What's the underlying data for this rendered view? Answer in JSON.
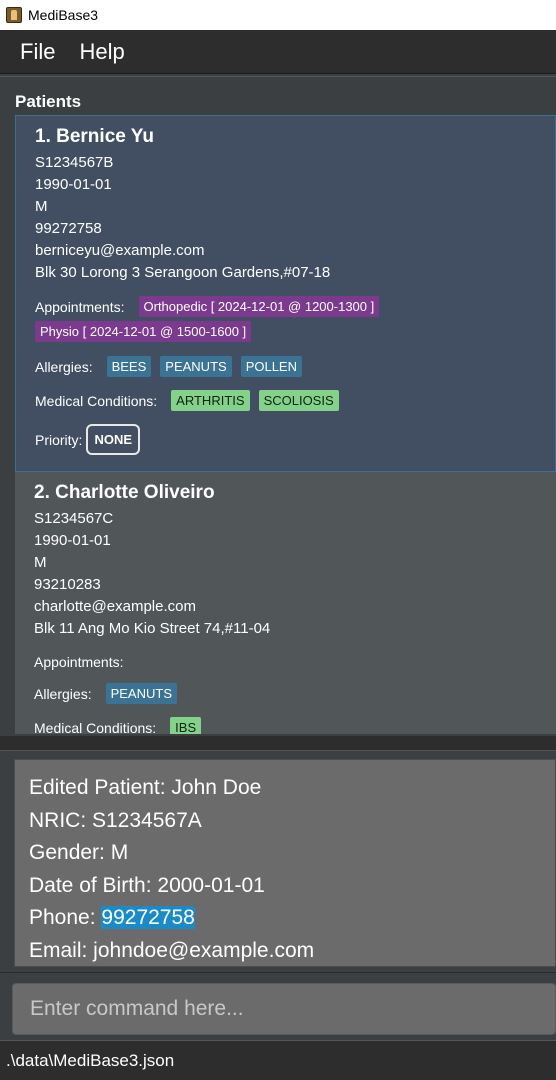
{
  "window": {
    "title": "MediBase3"
  },
  "menu": {
    "file": "File",
    "help": "Help"
  },
  "patients": {
    "header": "Patients",
    "labels": {
      "appointments": "Appointments:",
      "allergies": "Allergies:",
      "conditions": "Medical Conditions:",
      "priority": "Priority:"
    },
    "list": [
      {
        "name": "1. Bernice Yu",
        "nric": "S1234567B",
        "dob": "1990-01-01",
        "gender": "M",
        "phone": "99272758",
        "email": "berniceyu@example.com",
        "address": "Blk 30 Lorong 3 Serangoon Gardens,#07-18",
        "appointments": [
          "Orthopedic [ 2024-12-01 @ 1200-1300 ]",
          "Physio [ 2024-12-01 @ 1500-1600 ]"
        ],
        "allergies": [
          "BEES",
          "PEANUTS",
          "POLLEN"
        ],
        "conditions": [
          "ARTHRITIS",
          "SCOLIOSIS"
        ],
        "priority": "NONE"
      },
      {
        "name": "2. Charlotte Oliveiro",
        "nric": "S1234567C",
        "dob": "1990-01-01",
        "gender": "M",
        "phone": "93210283",
        "email": "charlotte@example.com",
        "address": "Blk 11 Ang Mo Kio Street 74,#11-04",
        "appointments": [],
        "allergies": [
          "PEANUTS"
        ],
        "conditions": [
          "IBS"
        ]
      }
    ]
  },
  "result": {
    "line1": "Edited Patient: John Doe",
    "line2": "NRIC: S1234567A",
    "line3": "Gender: M",
    "line4": "Date of Birth: 2000-01-01",
    "phone_label": "Phone: ",
    "phone_value": "99272758",
    "line6": "Email: johndoe@example.com"
  },
  "command": {
    "placeholder": "Enter command here..."
  },
  "status": {
    "path": ".\\data\\MediBase3.json"
  }
}
